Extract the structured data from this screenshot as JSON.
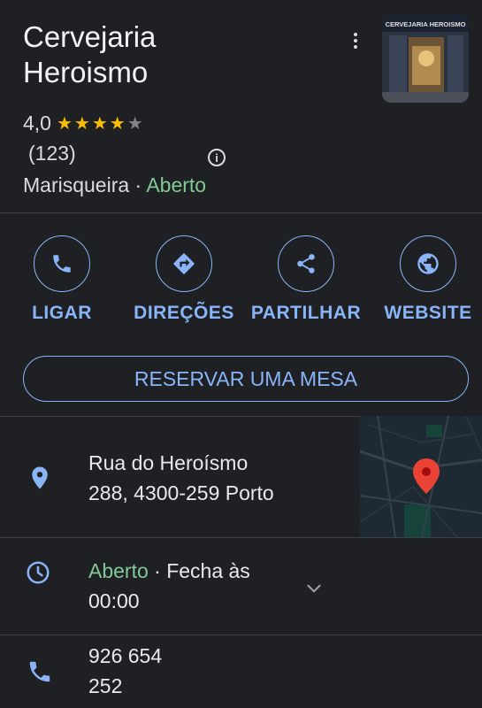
{
  "place": {
    "name_line1": "Cervejaria",
    "name_line2": "Heroismo",
    "rating": "4,0",
    "stars_filled": 4,
    "review_count": "(123)",
    "category": "Marisqueira",
    "separator": " · ",
    "status": "Aberto",
    "thumbnail_sign": "CERVEJARIA HEROISMO"
  },
  "actions": [
    {
      "label": "LIGAR",
      "icon": "phone-icon"
    },
    {
      "label": "DIREÇÕES",
      "icon": "directions-icon"
    },
    {
      "label": "PARTILHAR",
      "icon": "share-icon"
    },
    {
      "label": "WEBSITE",
      "icon": "globe-icon"
    }
  ],
  "reserve_label": "RESERVAR UMA MESA",
  "address": {
    "line1": "Rua do Heroísmo",
    "line2": "288, 4300-259 Porto"
  },
  "hours": {
    "status": "Aberto",
    "text": " · Fecha às",
    "time": "00:00"
  },
  "phone": {
    "line1": "926 654",
    "line2": "252"
  },
  "colors": {
    "background": "#1f2023",
    "accent": "#8ab4f8",
    "open": "#81c995",
    "star": "#fbbc04",
    "pin": "#ea4335"
  }
}
